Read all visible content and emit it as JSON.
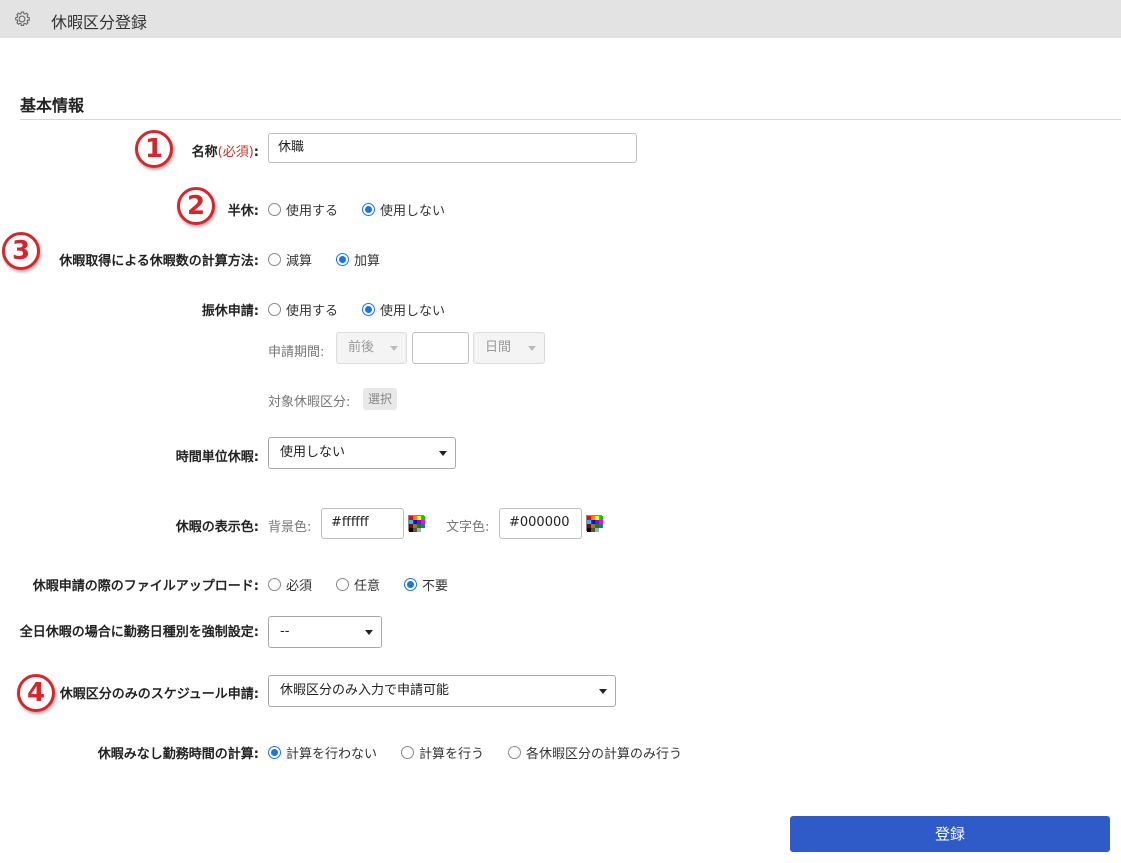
{
  "window": {
    "title": "休暇区分登録",
    "icon": "gear-icon"
  },
  "section": {
    "title": "基本情報"
  },
  "badges": [
    "1",
    "2",
    "3",
    "4"
  ],
  "name_field": {
    "label": "名称",
    "required": "(必須)",
    "colon": ":",
    "value": "休職"
  },
  "half_day": {
    "label": "半休:",
    "options": [
      "使用する",
      "使用しない"
    ],
    "selected": 1
  },
  "calc_method": {
    "label": "休暇取得による休暇数の計算方法:",
    "options": [
      "減算",
      "加算"
    ],
    "selected": 1
  },
  "substitute": {
    "label": "振休申請:",
    "options": [
      "使用する",
      "使用しない"
    ],
    "selected": 1,
    "period_label": "申請期間:",
    "period_select": "前後",
    "period_value": "",
    "unit_select": "日間",
    "target_label": "対象休暇区分:",
    "target_button": "選択"
  },
  "hourly": {
    "label": "時間単位休暇:",
    "value": "使用しない"
  },
  "display_color": {
    "label": "休暇の表示色:",
    "bg_label": "背景色:",
    "bg_value": "#ffffff",
    "fg_label": "文字色:",
    "fg_value": "#000000",
    "icon": "color-palette-icon"
  },
  "file_upload": {
    "label": "休暇申請の際のファイルアップロード:",
    "options": [
      "必須",
      "任意",
      "不要"
    ],
    "selected": 2
  },
  "force_daytype": {
    "label": "全日休暇の場合に勤務日種別を強制設定:",
    "value": "--"
  },
  "schedule_request": {
    "label": "休暇区分のみのスケジュール申請:",
    "value": "休暇区分のみ入力で申請可能"
  },
  "deemed_hours": {
    "label": "休暇みなし勤務時間の計算:",
    "options": [
      "計算を行わない",
      "計算を行う",
      "各休暇区分の計算のみ行う"
    ],
    "selected": 0
  },
  "submit": {
    "label": "登録"
  },
  "colors": {
    "accent": "#2e5bc7",
    "radio": "#1a73e8",
    "required": "#c0392b",
    "badge": "#d7262b"
  }
}
